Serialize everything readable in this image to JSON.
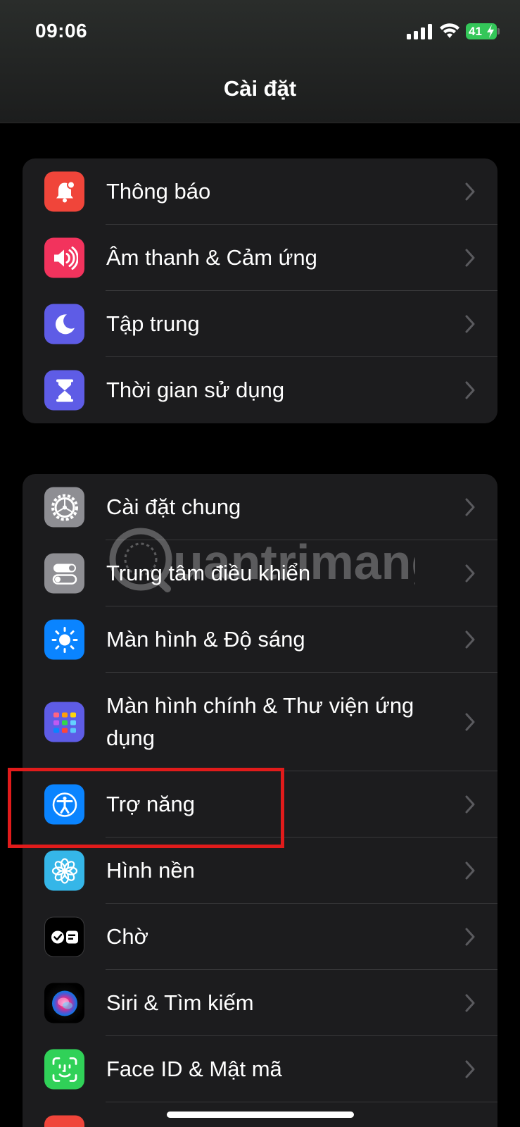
{
  "status_bar": {
    "time": "09:06",
    "battery": "41"
  },
  "header": {
    "title": "Cài đặt"
  },
  "group1": [
    {
      "label": "Thông báo",
      "icon": "bell-icon",
      "color": "#f0453a"
    },
    {
      "label": "Âm thanh & Cảm ứng",
      "icon": "speaker-icon",
      "color": "#f2335d"
    },
    {
      "label": "Tập trung",
      "icon": "moon-icon",
      "color": "#5e5ce6"
    },
    {
      "label": "Thời gian sử dụng",
      "icon": "hourglass-icon",
      "color": "#5e5ce6"
    }
  ],
  "group2": [
    {
      "label": "Cài đặt chung",
      "icon": "gear-icon",
      "color": "#8e8e93"
    },
    {
      "label": "Trung tâm điều khiển",
      "icon": "toggles-icon",
      "color": "#8e8e93"
    },
    {
      "label": "Màn hình & Độ sáng",
      "icon": "sun-icon",
      "color": "#0a84ff"
    },
    {
      "label": "Màn hình chính & Thư viện ứng dụng",
      "icon": "app-grid-icon",
      "color": "#5e5ce6"
    },
    {
      "label": "Trợ năng",
      "icon": "accessibility-icon",
      "color": "#0a84ff"
    },
    {
      "label": "Hình nền",
      "icon": "flower-icon",
      "color": "#35b6e8"
    },
    {
      "label": "Chờ",
      "icon": "standby-icon",
      "color": "#000000"
    },
    {
      "label": "Siri & Tìm kiếm",
      "icon": "siri-icon",
      "color": "#1c1c1e"
    },
    {
      "label": "Face ID & Mật mã",
      "icon": "face-id-icon",
      "color": "#30d158"
    }
  ],
  "watermark": {
    "text": "uantrimang"
  }
}
